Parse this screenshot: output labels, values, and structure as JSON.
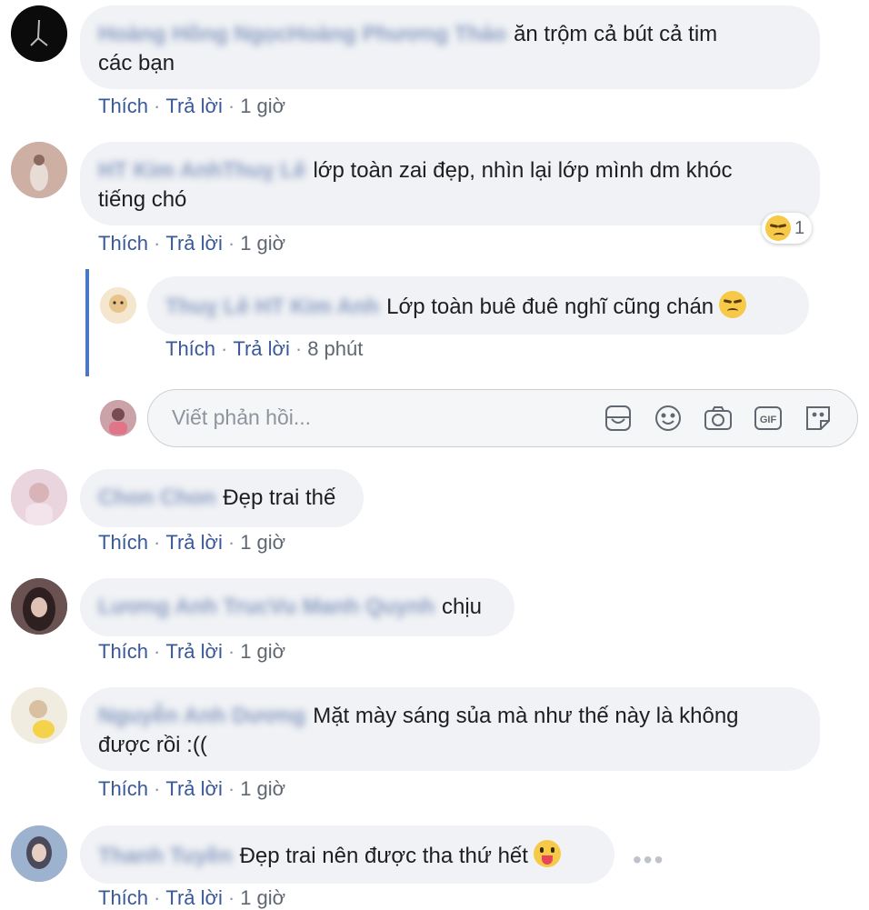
{
  "colors": {
    "link": "#385898",
    "bubble": "#f0f2f5",
    "reply_bar": "#4a76c7"
  },
  "comments": [
    {
      "name": "Hoàng Hồng NgọcHoàng Phương Thảo",
      "text_line1": "ăn trộm cả bút cả tim",
      "text_line2": "các bạn",
      "like": "Thích",
      "reply": "Trả lời",
      "time": "1 giờ"
    },
    {
      "name": "HT Kim AnhThuỵ Lê",
      "text_line1": "lớp toàn zai đẹp, nhìn lại lớp mình dm khóc",
      "text_line2": "tiếng chó",
      "like": "Thích",
      "reply": "Trả lời",
      "time": "1 giờ",
      "reaction_count": "1",
      "reaction_icon": "crying-face-icon"
    },
    {
      "name": "Chon Chon",
      "text": "Đẹp trai thế",
      "like": "Thích",
      "reply": "Trả lời",
      "time": "1 giờ"
    },
    {
      "name": "Lương Anh TrucVu Manh Quynh",
      "text": "chịu",
      "like": "Thích",
      "reply": "Trả lời",
      "time": "1 giờ"
    },
    {
      "name": "Nguyễn Anh Dương",
      "text_line1": "Mặt mày sáng sủa mà như thế này là không",
      "text_line2": "được rồi :((",
      "like": "Thích",
      "reply": "Trả lời",
      "time": "1 giờ"
    },
    {
      "name": "Thanh Tuyền",
      "text": "Đẹp trai nên được tha thứ hết",
      "emoji": "tongue-face-icon",
      "like": "Thích",
      "reply": "Trả lời",
      "time": "1 giờ",
      "more": "•••"
    }
  ],
  "reply": {
    "name": "Thuỵ Lê HT Kim Anh",
    "text": "Lớp toàn buê đuê nghĩ cũng chán",
    "emoji": "disappointed-face-icon",
    "like": "Thích",
    "reply": "Trả lời",
    "time": "8 phút"
  },
  "reply_input": {
    "placeholder": "Viết phản hồi...",
    "icons": [
      "sticker-icon",
      "emoji-icon",
      "camera-icon",
      "gif-icon",
      "sticker-pack-icon"
    ]
  },
  "separator": "·"
}
